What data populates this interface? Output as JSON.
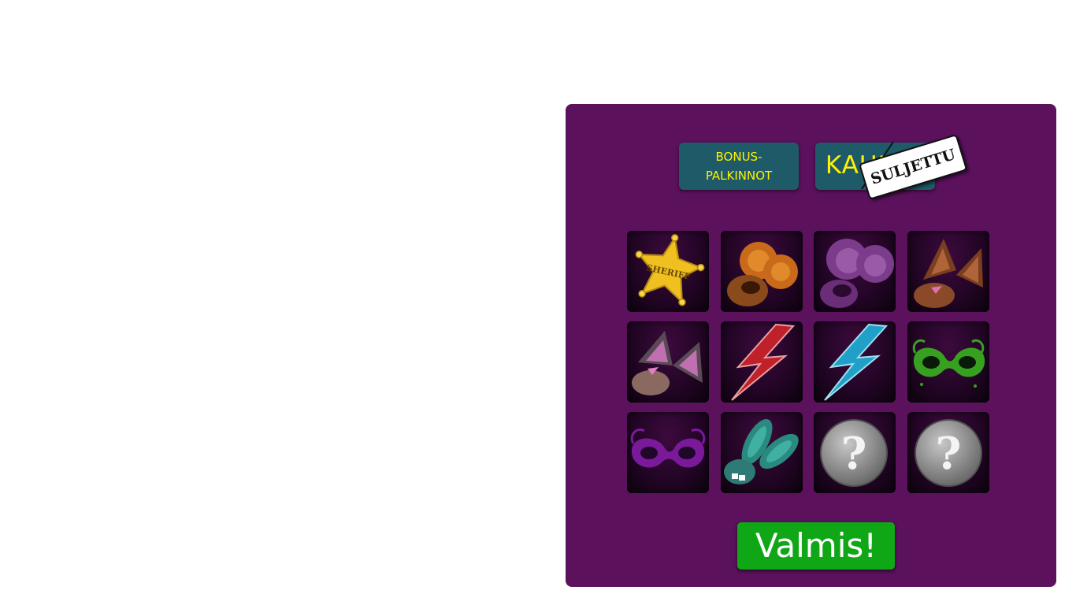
{
  "tabs": {
    "bonus_label": "BONUS-\nPALKINNOT",
    "shop_label": "KAUPPA",
    "closed_sign": "SULJETTU"
  },
  "items": [
    {
      "name": "sheriff-badge-icon",
      "badge_text": "SHERIFF"
    },
    {
      "name": "orange-bear-ears-icon"
    },
    {
      "name": "purple-mouse-ears-icon"
    },
    {
      "name": "brown-cat-ears-icon"
    },
    {
      "name": "pink-cat-ears-icon"
    },
    {
      "name": "red-lightning-bolt-icon"
    },
    {
      "name": "blue-lightning-bolt-icon"
    },
    {
      "name": "green-mask-icon"
    },
    {
      "name": "purple-mask-icon"
    },
    {
      "name": "teal-bunny-ears-icon"
    },
    {
      "name": "locked-item-question-icon",
      "label": "?"
    },
    {
      "name": "locked-item-question-icon",
      "label": "?"
    }
  ],
  "ready_button": "Valmis!",
  "colors": {
    "panel": "#5b115c",
    "tab": "#1f5a68",
    "tab_text": "#fff200",
    "ready": "#10a716"
  }
}
